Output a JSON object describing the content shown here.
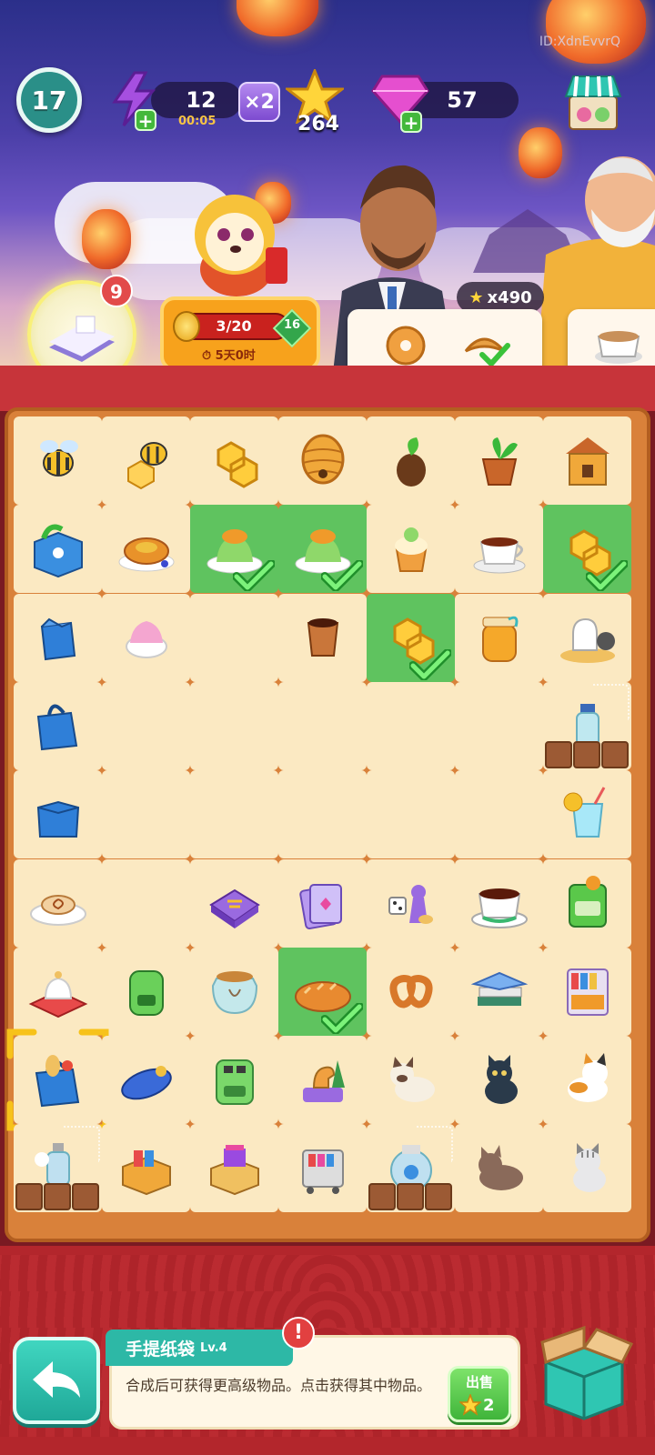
{
  "header": {
    "player_id": "ID:XdnEvvrQ",
    "level": "17",
    "energy": "12",
    "energy_timer": "00:05",
    "multiplier": "×2",
    "stars": "264",
    "gems": "57",
    "icons": {
      "energy": "lightning-bolt-icon",
      "star": "star-icon",
      "gem": "pink-gem-icon",
      "shop": "shop-stall-icon"
    }
  },
  "event": {
    "task_count": "9",
    "progress": "3/20",
    "reward_gems": "16",
    "time_left": "5天0时"
  },
  "orders": {
    "reward": "x490",
    "items": [
      "bagel-icon",
      "croissant-icon"
    ],
    "next_item": "latte-icon"
  },
  "board": {
    "rows": [
      [
        "bee",
        "bee-honeycomb",
        "honeycomb",
        "beehive",
        "sprout-seed",
        "potted-plant",
        "beehouse"
      ],
      [
        "gift-box",
        "pancakes",
        "pudding",
        "pudding",
        "cupcake",
        "tea-cup",
        "honeycomb"
      ],
      [
        "paper-bag-lv1",
        "frozen-yogurt",
        "",
        "coffee-cup",
        "honeycomb",
        "honey-jar",
        "tea-set"
      ],
      [
        "paper-bag-lv3",
        "",
        "",
        "",
        "",
        "",
        "water-bottle"
      ],
      [
        "paper-bag-lv2",
        "",
        "",
        "",
        "",
        "",
        "lemonade"
      ],
      [
        "cinnamon-coffee",
        "",
        "puzzle-box",
        "card-stack",
        "board-game",
        "coffee-cup-saucer",
        "green-machine"
      ],
      [
        "teapot-tray",
        "green-bin",
        "glass-jar",
        "bread-loaf",
        "pretzel",
        "book-stack",
        "book-cart"
      ],
      [
        "paper-bag-lv4",
        "pencil-case",
        "green-machine-2",
        "dino-toy",
        "siamese-cat",
        "black-cat",
        "calico-cat"
      ],
      [
        "water-bottle-2",
        "book-drawer",
        "book-box",
        "book-cart-2",
        "glass-jar-2",
        "brown-cat",
        "tabby-cat"
      ]
    ],
    "checked": [
      [
        1,
        2
      ],
      [
        1,
        3
      ],
      [
        1,
        6
      ],
      [
        2,
        4
      ],
      [
        6,
        3
      ]
    ],
    "selected": [
      7,
      0
    ]
  },
  "item_info": {
    "name": "手提纸袋",
    "level": "Lv.4",
    "description": "合成后可获得更高级物品。点击获得其中物品。",
    "sell_label": "出售",
    "sell_price": "2",
    "alert": "!"
  },
  "colors": {
    "cell": "#fbe9c2",
    "cell_done": "#5fc35f",
    "frame": "#d9813a",
    "teal": "#2db8a6",
    "red": "#b3262c"
  }
}
